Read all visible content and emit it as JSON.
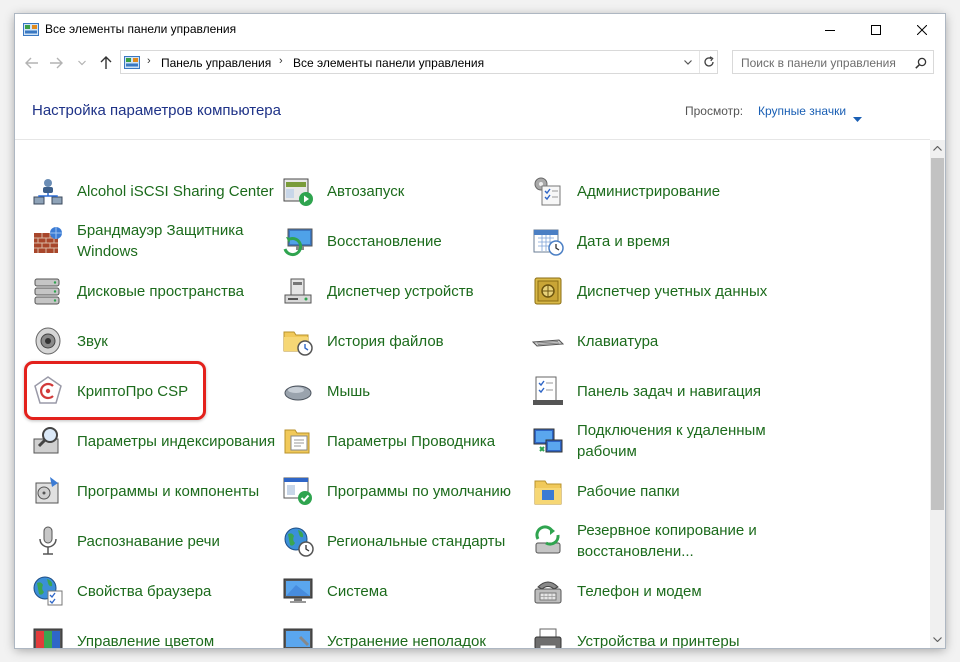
{
  "window": {
    "title": "Все элементы панели управления"
  },
  "address": {
    "crumbs": [
      "Панель управления",
      "Все элементы панели управления"
    ],
    "separator": "›"
  },
  "search": {
    "placeholder": "Поиск в панели управления"
  },
  "header": {
    "heading": "Настройка параметров компьютера",
    "view_label": "Просмотр:",
    "view_value": "Крупные значки"
  },
  "colors": {
    "link_green": "#1c6b1c",
    "heading_blue": "#1e3287",
    "accent_blue": "#1a5fb4",
    "highlight_red": "#e3211c"
  },
  "items": [
    {
      "label": "Alcohol iSCSI Sharing Center",
      "icon": "network-users-icon"
    },
    {
      "label": "Автозапуск",
      "icon": "autoplay-icon"
    },
    {
      "label": "Администрирование",
      "icon": "admin-tools-icon"
    },
    {
      "label": "Брандмауэр Защитника Windows",
      "icon": "firewall-icon"
    },
    {
      "label": "Восстановление",
      "icon": "recovery-icon"
    },
    {
      "label": "Дата и время",
      "icon": "calendar-clock-icon"
    },
    {
      "label": "Дисковые пространства",
      "icon": "storage-spaces-icon"
    },
    {
      "label": "Диспетчер устройств",
      "icon": "device-manager-icon"
    },
    {
      "label": "Диспетчер учетных данных",
      "icon": "credential-vault-icon"
    },
    {
      "label": "Звук",
      "icon": "speaker-icon"
    },
    {
      "label": "История файлов",
      "icon": "file-history-icon"
    },
    {
      "label": "Клавиатура",
      "icon": "keyboard-icon"
    },
    {
      "label": "КриптоПро CSP",
      "icon": "cryptopro-icon"
    },
    {
      "label": "Мышь",
      "icon": "mouse-icon"
    },
    {
      "label": "Панель задач и навигация",
      "icon": "taskbar-icon"
    },
    {
      "label": "Параметры индексирования",
      "icon": "indexing-icon"
    },
    {
      "label": "Параметры Проводника",
      "icon": "folder-options-icon"
    },
    {
      "label": "Подключения к удаленным рабочим",
      "icon": "remote-desktop-icon"
    },
    {
      "label": "Программы и компоненты",
      "icon": "programs-icon"
    },
    {
      "label": "Программы по умолчанию",
      "icon": "default-programs-icon"
    },
    {
      "label": "Рабочие папки",
      "icon": "work-folders-icon"
    },
    {
      "label": "Распознавание речи",
      "icon": "microphone-icon"
    },
    {
      "label": "Региональные стандарты",
      "icon": "region-globe-icon"
    },
    {
      "label": "Резервное копирование и восстановлени...",
      "icon": "backup-icon"
    },
    {
      "label": "Свойства браузера",
      "icon": "internet-options-icon"
    },
    {
      "label": "Система",
      "icon": "system-monitor-icon"
    },
    {
      "label": "Телефон и модем",
      "icon": "phone-modem-icon"
    },
    {
      "label": "Управление цветом",
      "icon": "color-management-icon"
    },
    {
      "label": "Устранение неполадок",
      "icon": "troubleshooting-icon"
    },
    {
      "label": "Устройства и принтеры",
      "icon": "printer-icon"
    }
  ]
}
